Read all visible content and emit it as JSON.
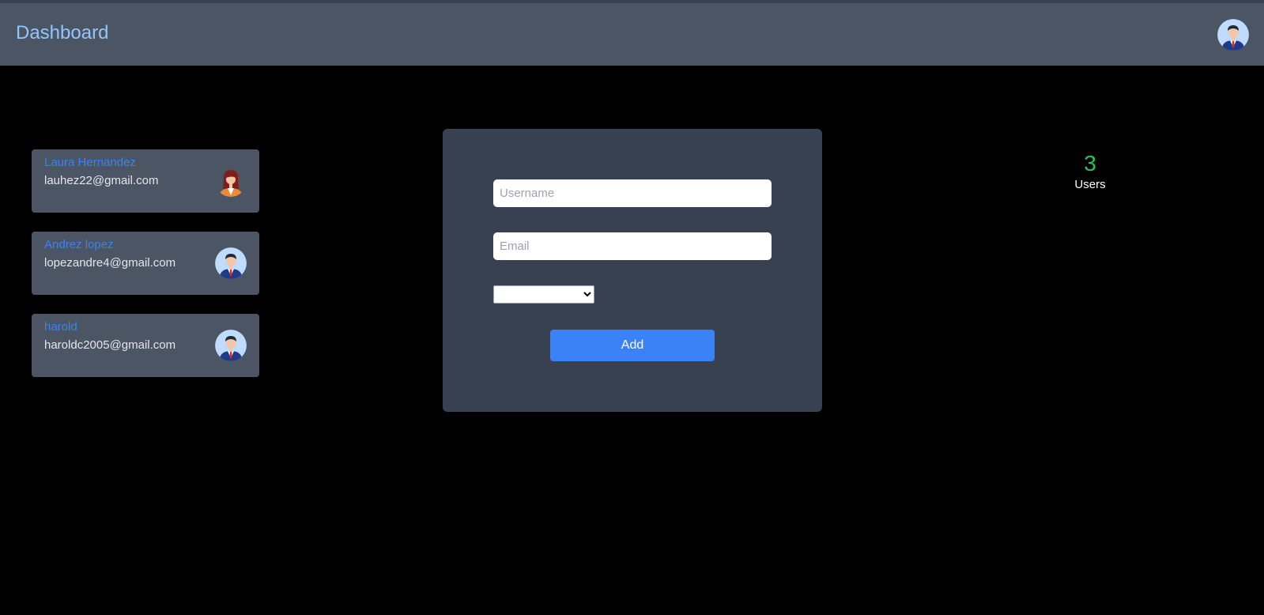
{
  "header": {
    "title": "Dashboard"
  },
  "users": [
    {
      "name": "Laura Hernandez",
      "email": "lauhez22@gmail.com",
      "avatar": "female-avatar-icon"
    },
    {
      "name": "Andrez lopez",
      "email": "lopezandre4@gmail.com",
      "avatar": "male-avatar-icon"
    },
    {
      "name": "harold",
      "email": "haroldc2005@gmail.com",
      "avatar": "male-avatar-icon"
    }
  ],
  "form": {
    "username_placeholder": "Username",
    "email_placeholder": "Email",
    "username_value": "",
    "email_value": "",
    "add_label": "Add"
  },
  "stats": {
    "count": "3",
    "label": "Users"
  },
  "colors": {
    "background": "#000000",
    "navbar": "#4b5563",
    "card": "#4b5563",
    "panel": "#374151",
    "accent": "#3b82f6",
    "title": "#93c5fd",
    "count": "#22c55e"
  }
}
